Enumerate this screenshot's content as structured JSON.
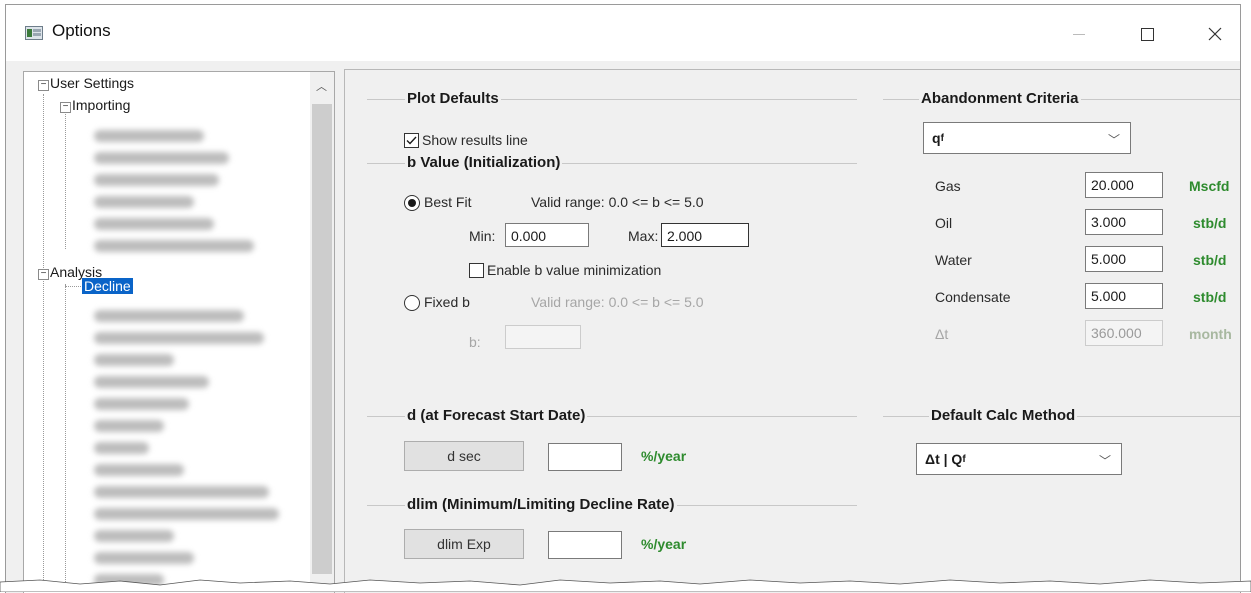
{
  "window": {
    "title": "Options",
    "icon": "options-app-icon",
    "controls": {
      "minimize": "minimize-icon",
      "maximize": "maximize-icon",
      "close": "close-icon"
    }
  },
  "tree": {
    "root": "User Settings",
    "importing": "Importing",
    "analysis": "Analysis",
    "decline": "Decline",
    "bottom_partial": "ll Cont"
  },
  "plot_defaults": {
    "title": "Plot Defaults",
    "show_results_line": {
      "label": "Show results line",
      "checked": true
    }
  },
  "b_value": {
    "title": "b Value (Initialization)",
    "best_fit": {
      "label": "Best Fit",
      "selected": true,
      "range": "Valid range:  0.0 <= b <= 5.0"
    },
    "min_label": "Min:",
    "min_value": "0.000",
    "max_label": "Max:",
    "max_value": "2.000",
    "enable_min": {
      "label": "Enable b value minimization",
      "checked": false
    },
    "fixed_b": {
      "label": "Fixed b",
      "selected": false,
      "range": "Valid range:  0.0 <= b <= 5.0"
    },
    "b_label": "b:",
    "b_value": ""
  },
  "d_forecast": {
    "title": "d (at Forecast Start Date)",
    "button": "d sec",
    "value": "",
    "unit": "%/year"
  },
  "dlim": {
    "title": "dlim (Minimum/Limiting Decline Rate)",
    "button": "dlim Exp",
    "value": "",
    "unit": "%/year"
  },
  "abandonment": {
    "title": "Abandonment Criteria",
    "selector_main": "q",
    "selector_sub": "f",
    "rows": [
      {
        "label": "Gas",
        "value": "20.000",
        "unit": "Mscfd",
        "enabled": true
      },
      {
        "label": "Oil",
        "value": "3.000",
        "unit": "stb/d",
        "enabled": true
      },
      {
        "label": "Water",
        "value": "5.000",
        "unit": "stb/d",
        "enabled": true
      },
      {
        "label": "Condensate",
        "value": "5.000",
        "unit": "stb/d",
        "enabled": true
      },
      {
        "label": "Δt",
        "value": "360.000",
        "unit": "month",
        "enabled": false
      }
    ]
  },
  "calc_method": {
    "title": "Default Calc Method",
    "selected_main": "Δt | Q",
    "selected_sub": "f"
  },
  "colors": {
    "unit_green": "#2e8b2e",
    "selection_blue": "#0a64c8",
    "panel_bg": "#f0f0f0"
  }
}
